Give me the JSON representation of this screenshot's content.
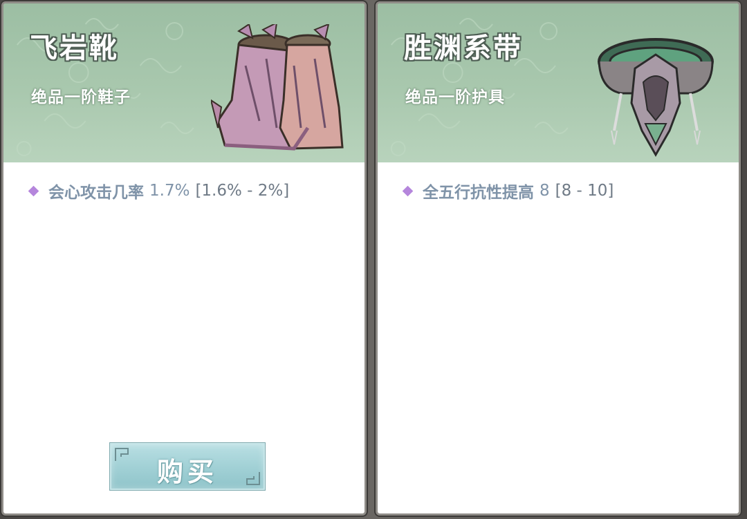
{
  "cards": [
    {
      "name": "飞岩靴",
      "grade": "绝品一阶鞋子",
      "art_icon": "boots-icon",
      "stat": {
        "label": "会心攻击几率",
        "value": "1.7%",
        "range": "[1.6% - 2%]"
      },
      "buy_label": "购买"
    },
    {
      "name": "胜渊系带",
      "grade": "绝品一阶护具",
      "art_icon": "belt-icon",
      "stat": {
        "label": "全五行抗性提高",
        "value": "8",
        "range": "[8 - 10]"
      }
    }
  ],
  "colors": {
    "header_green": "#a9c8ae",
    "stat_text": "#7f93a8",
    "diamond": "#b586dc",
    "button": "#a2d1d6"
  }
}
